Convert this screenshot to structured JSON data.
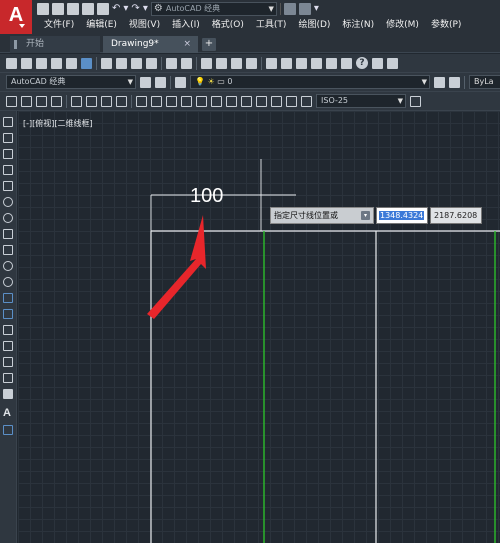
{
  "app": {
    "logo": "A",
    "workspace": "AutoCAD 经典"
  },
  "menu": [
    "文件(F)",
    "编辑(E)",
    "视图(V)",
    "插入(I)",
    "格式(O)",
    "工具(T)",
    "绘图(D)",
    "标注(N)",
    "修改(M)",
    "参数(P)"
  ],
  "tabs": {
    "start": "开始",
    "drawing": "Drawing9*",
    "close": "×",
    "add": "+"
  },
  "toolbars": {
    "workspace_select": "AutoCAD 经典",
    "layer_select": "0",
    "color_select": "ByLa",
    "dimstyle_select": "ISO-25",
    "help": "?"
  },
  "canvas": {
    "viewport_label": "[-][俯视][二维线框]",
    "dimension_text": "100",
    "grid_color": "#2b333c",
    "line_color": "#e9ecef",
    "green_line_color": "#2bbd2b",
    "arrow_color": "#e8262b"
  },
  "dynamic_input": {
    "prompt": "指定尺寸线位置或",
    "value_1": "1348.4324",
    "value_2": "2187.6208"
  },
  "palette": {
    "text_tool": "A"
  }
}
